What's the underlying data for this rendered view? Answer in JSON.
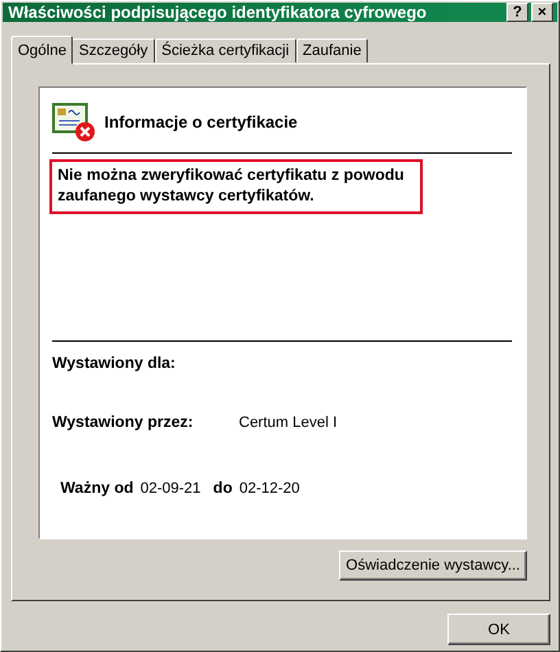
{
  "window": {
    "title": "Właściwości podpisującego identyfikatora cyfrowego",
    "buttons": [
      "?",
      "×"
    ]
  },
  "tabs": [
    {
      "label": "Ogólne",
      "selected": true
    },
    {
      "label": "Szczegóły",
      "selected": false
    },
    {
      "label": "Ścieżka certyfikacji",
      "selected": false
    },
    {
      "label": "Zaufanie",
      "selected": false
    }
  ],
  "info": {
    "title": "Informacje o certyfikacie",
    "warning": "Nie można zweryfikować certyfikatu z powodu zaufanego wystawcy certyfikatów.",
    "issued_to_label": "Wystawiony dla:",
    "issued_by_label": "Wystawiony przez:",
    "issued_by_value": "Certum Level I",
    "valid_from_label": "Ważny od",
    "valid_from": "02-09-21",
    "valid_to_label": "do",
    "valid_to": "02-12-20"
  },
  "issuer_button": "Oświadczenie wystawcy...",
  "ok_button": "OK"
}
